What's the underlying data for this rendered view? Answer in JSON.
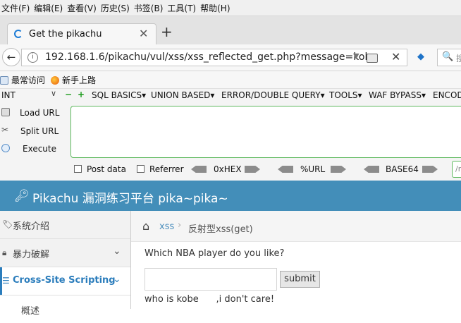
{
  "menubar": [
    "文件(F)",
    "编辑(E)",
    "查看(V)",
    "历史(S)",
    "书签(B)",
    "工具(T)",
    "帮助(H)"
  ],
  "tab": {
    "title": "Get the pikachu",
    "close": "✕",
    "new_tab": "+"
  },
  "navbar": {
    "back": "←",
    "url": "192.168.1.6/pikachu/vul/xss/xss_reflected_get.php?message=kob",
    "clear": "✕",
    "search_text": "搜"
  },
  "bookmarks": [
    "最常访问",
    "新手上路"
  ],
  "hackbar": {
    "select_value": "INT",
    "menus": [
      "SQL BASICS▾",
      "UNION BASED▾",
      "ERROR/DOUBLE QUERY▾",
      "TOOLS▾",
      "WAF BYPASS▾",
      "ENCODING▾"
    ],
    "load_url": "Load URL",
    "split_url": "Split URL",
    "execute": "Execute",
    "post_data": "Post data",
    "referrer": "Referrer",
    "hex": "0xHEX",
    "url_enc": "%URL",
    "base64": "BASE64",
    "small_field": "/r"
  },
  "header": {
    "title": "Pikachu 漏洞练习平台 pika~pika~"
  },
  "sidebar": {
    "items": [
      {
        "label": "系统介绍"
      },
      {
        "label": "暴力破解"
      },
      {
        "label": "Cross-Site Scripting"
      },
      {
        "label": "概述"
      }
    ]
  },
  "breadcrumb": {
    "link": "xss",
    "current": "反射型xss(get)"
  },
  "main": {
    "question": "Which NBA player do you like?",
    "submit": "submit",
    "result": "who is kobe      ,i don't care!"
  }
}
